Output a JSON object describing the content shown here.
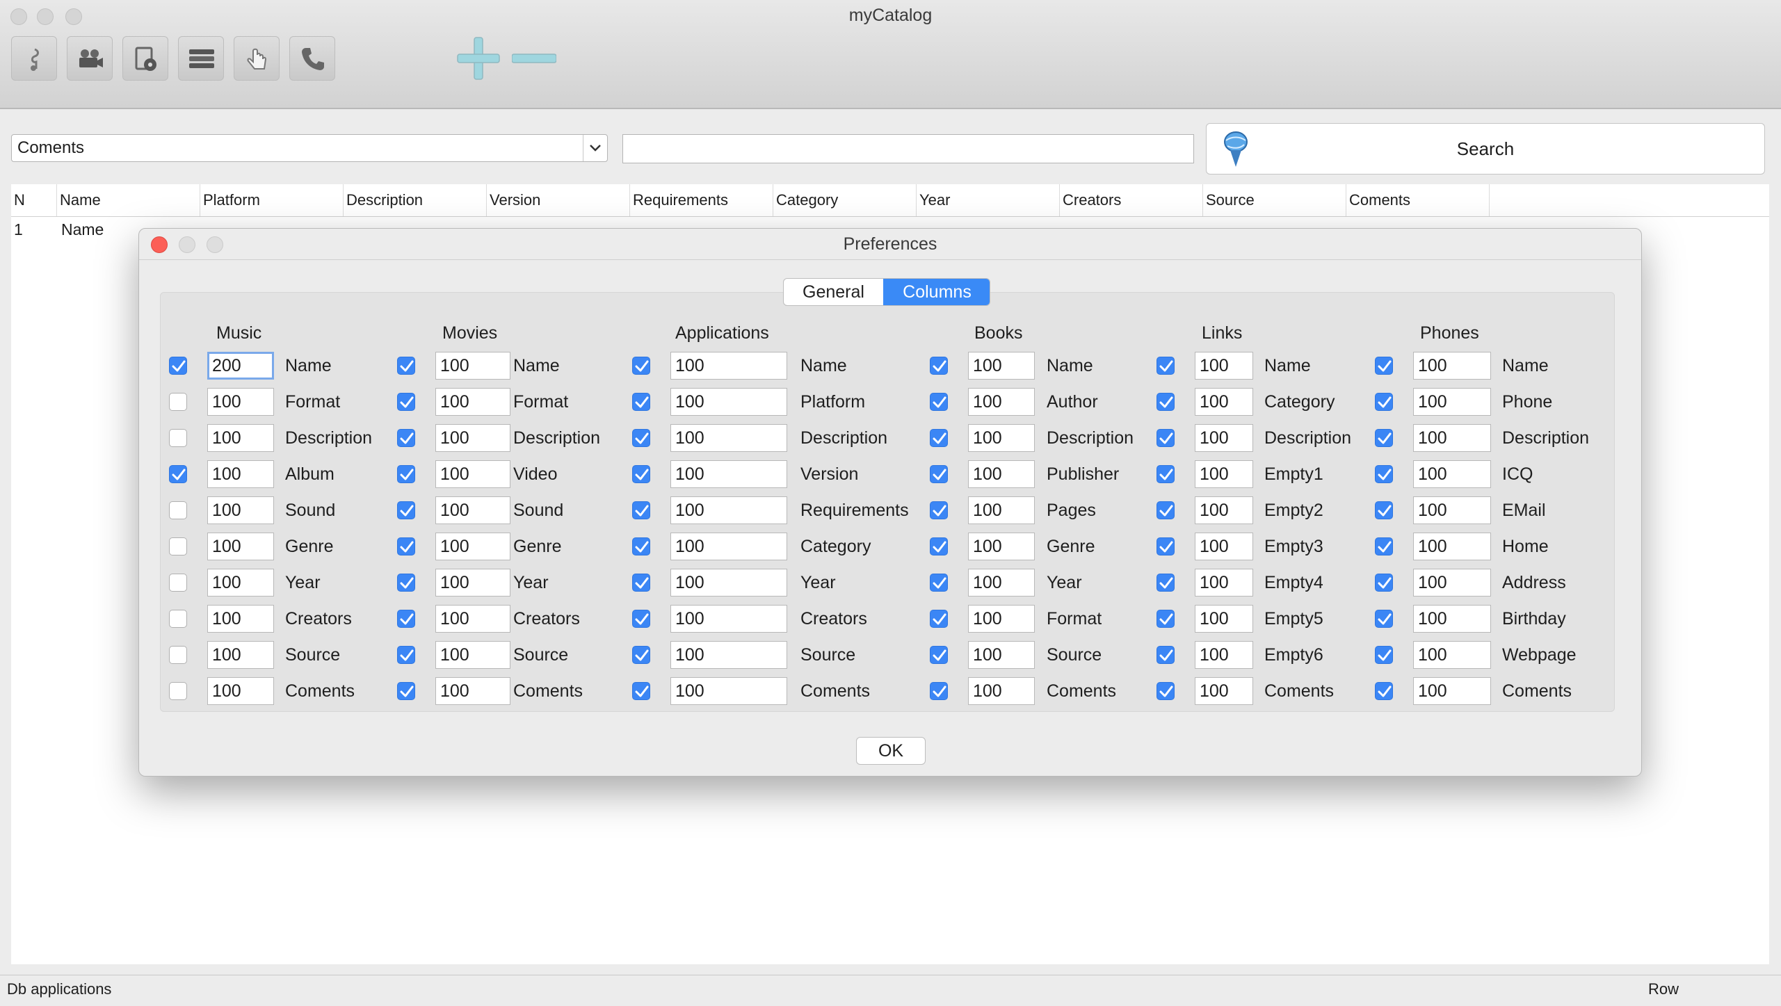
{
  "window": {
    "title": "myCatalog"
  },
  "toolbar": {
    "buttons": [
      {
        "name": "music",
        "icon": "music-note-icon"
      },
      {
        "name": "movies",
        "icon": "movie-camera-icon"
      },
      {
        "name": "applications",
        "icon": "application-disc-icon"
      },
      {
        "name": "books",
        "icon": "books-stack-icon"
      },
      {
        "name": "links",
        "icon": "hand-pointer-icon"
      },
      {
        "name": "phones",
        "icon": "phone-icon"
      }
    ],
    "add_icon": "plus-icon",
    "remove_icon": "minus-icon",
    "accent": "#9fd6df"
  },
  "filter": {
    "field_selected": "Coments",
    "search_value": "",
    "search_label": "Search"
  },
  "table": {
    "columns": [
      "N",
      "Name",
      "Platform",
      "Description",
      "Version",
      "Requirements",
      "Category",
      "Year",
      "Creators",
      "Source",
      "Coments"
    ],
    "rows": [
      {
        "n": "1",
        "name": "Name"
      }
    ]
  },
  "status": {
    "left": "Db applications",
    "right": "Row"
  },
  "dialog": {
    "title": "Preferences",
    "tabs": [
      {
        "label": "General",
        "selected": false
      },
      {
        "label": "Columns",
        "selected": true
      }
    ],
    "ok_label": "OK",
    "accent": "#3a8af6",
    "groups": [
      {
        "title": "Music",
        "rows": [
          {
            "label": "Name",
            "width": "200",
            "checked": true
          },
          {
            "label": "Format",
            "width": "100",
            "checked": false
          },
          {
            "label": "Description",
            "width": "100",
            "checked": false
          },
          {
            "label": "Album",
            "width": "100",
            "checked": true
          },
          {
            "label": "Sound",
            "width": "100",
            "checked": false
          },
          {
            "label": "Genre",
            "width": "100",
            "checked": false
          },
          {
            "label": "Year",
            "width": "100",
            "checked": false
          },
          {
            "label": "Creators",
            "width": "100",
            "checked": false
          },
          {
            "label": "Source",
            "width": "100",
            "checked": false
          },
          {
            "label": "Coments",
            "width": "100",
            "checked": false
          }
        ]
      },
      {
        "title": "Movies",
        "rows": [
          {
            "label": "Name",
            "width": "100",
            "checked": true
          },
          {
            "label": "Format",
            "width": "100",
            "checked": true
          },
          {
            "label": "Description",
            "width": "100",
            "checked": true
          },
          {
            "label": "Video",
            "width": "100",
            "checked": true
          },
          {
            "label": "Sound",
            "width": "100",
            "checked": true
          },
          {
            "label": "Genre",
            "width": "100",
            "checked": true
          },
          {
            "label": "Year",
            "width": "100",
            "checked": true
          },
          {
            "label": "Creators",
            "width": "100",
            "checked": true
          },
          {
            "label": "Source",
            "width": "100",
            "checked": true
          },
          {
            "label": "Coments",
            "width": "100",
            "checked": true
          }
        ]
      },
      {
        "title": "Applications",
        "rows": [
          {
            "label": "Name",
            "width": "100",
            "checked": true
          },
          {
            "label": "Platform",
            "width": "100",
            "checked": true
          },
          {
            "label": "Description",
            "width": "100",
            "checked": true
          },
          {
            "label": "Version",
            "width": "100",
            "checked": true
          },
          {
            "label": "Requirements",
            "width": "100",
            "checked": true
          },
          {
            "label": "Category",
            "width": "100",
            "checked": true
          },
          {
            "label": "Year",
            "width": "100",
            "checked": true
          },
          {
            "label": "Creators",
            "width": "100",
            "checked": true
          },
          {
            "label": "Source",
            "width": "100",
            "checked": true
          },
          {
            "label": "Coments",
            "width": "100",
            "checked": true
          }
        ]
      },
      {
        "title": "Books",
        "rows": [
          {
            "label": "Name",
            "width": "100",
            "checked": true
          },
          {
            "label": "Author",
            "width": "100",
            "checked": true
          },
          {
            "label": "Description",
            "width": "100",
            "checked": true
          },
          {
            "label": "Publisher",
            "width": "100",
            "checked": true
          },
          {
            "label": "Pages",
            "width": "100",
            "checked": true
          },
          {
            "label": "Genre",
            "width": "100",
            "checked": true
          },
          {
            "label": "Year",
            "width": "100",
            "checked": true
          },
          {
            "label": "Format",
            "width": "100",
            "checked": true
          },
          {
            "label": "Source",
            "width": "100",
            "checked": true
          },
          {
            "label": "Coments",
            "width": "100",
            "checked": true
          }
        ]
      },
      {
        "title": "Links",
        "rows": [
          {
            "label": "Name",
            "width": "100",
            "checked": true
          },
          {
            "label": "Category",
            "width": "100",
            "checked": true
          },
          {
            "label": "Description",
            "width": "100",
            "checked": true
          },
          {
            "label": "Empty1",
            "width": "100",
            "checked": true
          },
          {
            "label": "Empty2",
            "width": "100",
            "checked": true
          },
          {
            "label": "Empty3",
            "width": "100",
            "checked": true
          },
          {
            "label": "Empty4",
            "width": "100",
            "checked": true
          },
          {
            "label": "Empty5",
            "width": "100",
            "checked": true
          },
          {
            "label": "Empty6",
            "width": "100",
            "checked": true
          },
          {
            "label": "Coments",
            "width": "100",
            "checked": true
          }
        ]
      },
      {
        "title": "Phones",
        "rows": [
          {
            "label": "Name",
            "width": "100",
            "checked": true
          },
          {
            "label": "Phone",
            "width": "100",
            "checked": true
          },
          {
            "label": "Description",
            "width": "100",
            "checked": true
          },
          {
            "label": "ICQ",
            "width": "100",
            "checked": true
          },
          {
            "label": "EMail",
            "width": "100",
            "checked": true
          },
          {
            "label": "Home",
            "width": "100",
            "checked": true
          },
          {
            "label": "Address",
            "width": "100",
            "checked": true
          },
          {
            "label": "Birthday",
            "width": "100",
            "checked": true
          },
          {
            "label": "Webpage",
            "width": "100",
            "checked": true
          },
          {
            "label": "Coments",
            "width": "100",
            "checked": true
          }
        ]
      }
    ]
  }
}
